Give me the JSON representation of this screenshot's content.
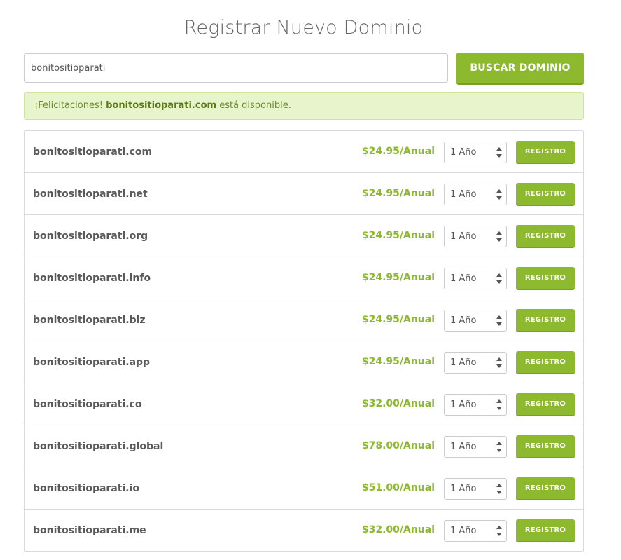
{
  "page": {
    "title": "Registrar Nuevo Dominio"
  },
  "search": {
    "value": "bonitositioparati",
    "button_label": "BUSCAR DOMINIO"
  },
  "banner": {
    "prefix": "¡Felicitaciones!",
    "domain": "bonitositioparati.com",
    "suffix": "está disponible."
  },
  "colors": {
    "accent": "#8cb92d",
    "banner_background": "#e8f5cc"
  },
  "results": [
    {
      "domain": "bonitositioparati.com",
      "price": "$24.95/Anual",
      "term": "1 Año",
      "button": "REGISTRO"
    },
    {
      "domain": "bonitositioparati.net",
      "price": "$24.95/Anual",
      "term": "1 Año",
      "button": "REGISTRO"
    },
    {
      "domain": "bonitositioparati.org",
      "price": "$24.95/Anual",
      "term": "1 Año",
      "button": "REGISTRO"
    },
    {
      "domain": "bonitositioparati.info",
      "price": "$24.95/Anual",
      "term": "1 Año",
      "button": "REGISTRO"
    },
    {
      "domain": "bonitositioparati.biz",
      "price": "$24.95/Anual",
      "term": "1 Año",
      "button": "REGISTRO"
    },
    {
      "domain": "bonitositioparati.app",
      "price": "$24.95/Anual",
      "term": "1 Año",
      "button": "REGISTRO"
    },
    {
      "domain": "bonitositioparati.co",
      "price": "$32.00/Anual",
      "term": "1 Año",
      "button": "REGISTRO"
    },
    {
      "domain": "bonitositioparati.global",
      "price": "$78.00/Anual",
      "term": "1 Año",
      "button": "REGISTRO"
    },
    {
      "domain": "bonitositioparati.io",
      "price": "$51.00/Anual",
      "term": "1 Año",
      "button": "REGISTRO"
    },
    {
      "domain": "bonitositioparati.me",
      "price": "$32.00/Anual",
      "term": "1 Año",
      "button": "REGISTRO"
    }
  ]
}
